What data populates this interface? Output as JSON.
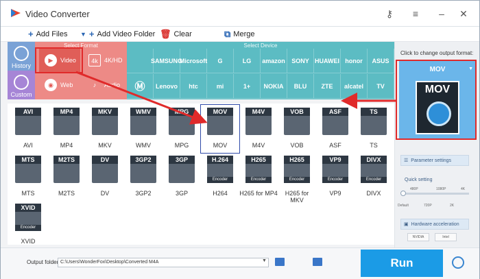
{
  "app": {
    "title": "Video Converter"
  },
  "toolbar": {
    "add_files": "Add Files",
    "add_video_folder": "Add Video Folder",
    "clear": "Clear",
    "merge": "Merge"
  },
  "side_tabs": {
    "history": "History",
    "custom": "Custom"
  },
  "format_panel": {
    "select_format_label": "Select Format",
    "select_device_label": "Select Device",
    "format_buttons": [
      "Video",
      "4K/HD",
      "Web",
      "Audio"
    ],
    "device_brands_row1": [
      "",
      "SAMSUNG",
      "Microsoft",
      "G",
      "LG",
      "amazon",
      "SONY",
      "HUAWEI",
      "honor",
      "ASUS"
    ],
    "device_brands_row2": [
      "",
      "Lenovo",
      "htc",
      "mi",
      "1+",
      "NOKIA",
      "BLU",
      "ZTE",
      "alcatel",
      "TV"
    ]
  },
  "tiles": [
    {
      "label": "AVI",
      "cap": "AVI"
    },
    {
      "label": "MP4",
      "cap": "MP4"
    },
    {
      "label": "MKV",
      "cap": "MKV"
    },
    {
      "label": "WMV",
      "cap": "WMV"
    },
    {
      "label": "MPG",
      "cap": "MPG"
    },
    {
      "label": "MOV",
      "cap": "MOV"
    },
    {
      "label": "M4V",
      "cap": "M4V"
    },
    {
      "label": "VOB",
      "cap": "VOB"
    },
    {
      "label": "ASF",
      "cap": "ASF"
    },
    {
      "label": "TS",
      "cap": "TS"
    },
    {
      "label": "MTS",
      "cap": "MTS"
    },
    {
      "label": "M2TS",
      "cap": "M2TS"
    },
    {
      "label": "DV",
      "cap": "DV"
    },
    {
      "label": "3GP2",
      "cap": "3GP2"
    },
    {
      "label": "3GP",
      "cap": "3GP"
    },
    {
      "label": "H264",
      "cap": "H.264"
    },
    {
      "label": "H265 for MP4",
      "cap": "H265"
    },
    {
      "label": "H265 for MKV",
      "cap": "H265"
    },
    {
      "label": "VP9",
      "cap": "VP9"
    },
    {
      "label": "DIVX",
      "cap": "DIVX"
    },
    {
      "label": "XVID",
      "cap": "XVID"
    }
  ],
  "tile_encoder_badge": "Encoder",
  "right_panel": {
    "hint": "Click to change output format:",
    "output_format": "MOV",
    "parameter_settings": "Parameter settings",
    "quick_setting": "Quick setting",
    "quick_top_labels": [
      "480P",
      "1080P",
      "4K"
    ],
    "quick_bottom_labels": [
      "Default",
      "720P",
      "2K"
    ],
    "hardware_acceleration": "Hardware acceleration",
    "chips": [
      "NVIDIA",
      "Intel"
    ]
  },
  "bottom": {
    "output_folder_label": "Output folder:",
    "output_path": "C:\\Users\\WonderFox\\Desktop\\Converted M4A",
    "run": "Run"
  },
  "colors": {
    "select_format_bg": "#ed8a86",
    "select_device_bg": "#5cbcc3",
    "run_bg": "#1b9be6",
    "annotation_red": "#e02a2a"
  }
}
